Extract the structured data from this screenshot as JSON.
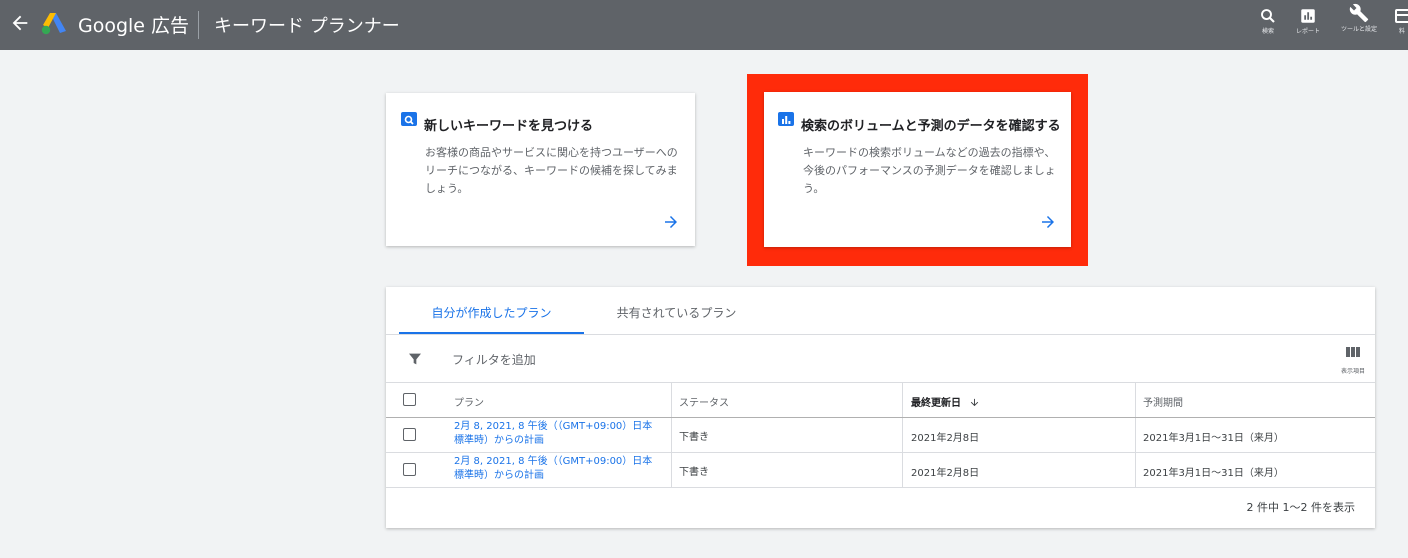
{
  "topbar": {
    "brand": "Google 広告",
    "page_title": "キーワード プランナー",
    "actions": [
      {
        "label": "検索",
        "icon": "search-icon"
      },
      {
        "label": "レポート",
        "icon": "reports-icon"
      },
      {
        "label": "ツールと設定",
        "icon": "wrench-icon"
      },
      {
        "label": "料",
        "icon": "billing-icon"
      }
    ]
  },
  "cards": {
    "discover": {
      "title": "新しいキーワードを見つける",
      "desc": "お客様の商品やサービスに関心を持つユーザーへのリーチにつながる、キーワードの候補を探してみましょう。",
      "icon": "search-icon"
    },
    "forecast": {
      "title": "検索のボリュームと予測のデータを確認する",
      "desc": "キーワードの検索ボリュームなどの過去の指標や、今後のパフォーマンスの予測データを確認しましょう。",
      "icon": "bar-chart-icon"
    }
  },
  "plans": {
    "tabs": [
      "自分が作成したプラン",
      "共有されているプラン"
    ],
    "filter_placeholder": "フィルタを追加",
    "columns_label": "表示項目",
    "headers": {
      "plan": "プラン",
      "status": "ステータス",
      "updated": "最終更新日",
      "period": "予測期間"
    },
    "rows": [
      {
        "plan": "2月 8, 2021, 8 午後（（GMT+09:00）日本標準時）からの計画",
        "status": "下書き",
        "updated": "2021年2月8日",
        "period": "2021年3月1日～31日（来月）"
      },
      {
        "plan": "2月 8, 2021, 8 午後（（GMT+09:00）日本標準時）からの計画",
        "status": "下書き",
        "updated": "2021年2月8日",
        "period": "2021年3月1日～31日（来月）"
      }
    ],
    "footer": "2 件中 1〜2 件を表示"
  },
  "colors": {
    "topbar": "#5f6368",
    "accent": "#1a73e8",
    "highlight": "#ff2b0a",
    "background": "#f1f3f4"
  }
}
